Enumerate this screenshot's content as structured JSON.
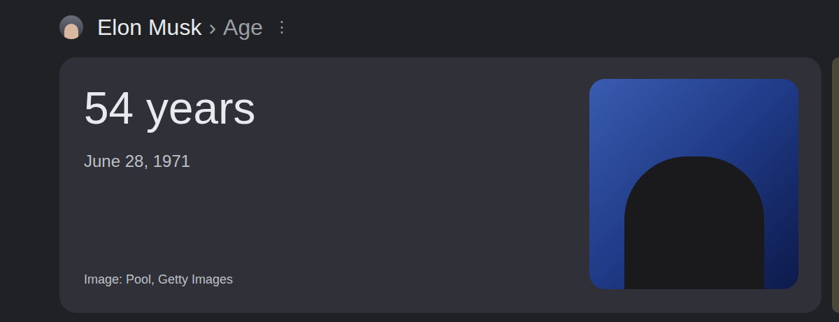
{
  "header": {
    "entity": "Elon Musk",
    "separator": "›",
    "attribute": "Age",
    "menu": "⋮"
  },
  "card": {
    "value": "54 years",
    "date": "June 28, 1971",
    "credit": "Image: Pool, Getty Images"
  }
}
